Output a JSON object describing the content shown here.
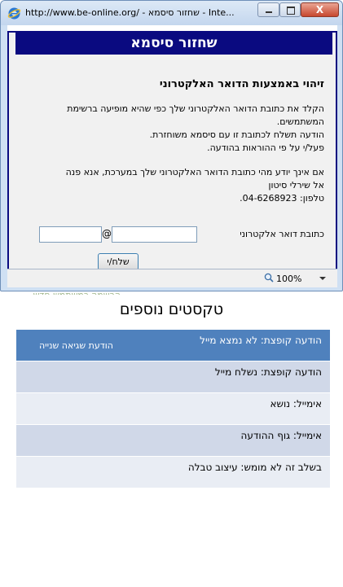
{
  "window": {
    "title": "http://www.be-online.org/ - שחזור סיסמא - Inte...",
    "icon": "internet-explorer-icon",
    "close_glyph": "X"
  },
  "page": {
    "banner": "שחזור סיסמא",
    "heading": "זיהוי באמצעות הדואר האלקטרוני",
    "para1": [
      "הקלד את כתובת הדואר האלקטרוני שלך כפי שהיא מופיעה ברשימת",
      "המשתמשים.",
      "הודעה תשלח לכתובת זו עם סיסמא משוחזרת.",
      "פעל/י על פי ההוראות בהודעה."
    ],
    "para2": [
      "אם אינך יודע מהי כתובת הדואר האלקטרוני שלך במערכת, אנא פנה",
      "אל שירלי סיטון",
      "טלפון: 04-6268923."
    ],
    "email_label": "כתובת דואר אלקטרוני",
    "email_user_value": "",
    "email_domain_value": "",
    "at_sign": "@",
    "send_label": "שלח/י"
  },
  "statusbar": {
    "zoom": "100%"
  },
  "behind_text": "הרשמה כמשתמש חדש",
  "document": {
    "title": "טקסטים נוספים",
    "rows": [
      {
        "text": "הודעה קופצת: לא נמצא מייל",
        "sub": "הודעת שגיאה שנייה"
      },
      {
        "text": "הודעה קופצת: נשלח מייל"
      },
      {
        "text": "אימייל: נושא"
      },
      {
        "text": "אימייל: גוף ההודעה"
      },
      {
        "text": "בשלב זה לא מומש: עיצוב טבלה"
      }
    ]
  },
  "colors": {
    "banner": "#0a0a80",
    "table_header": "#4f81bd",
    "table_row_dark": "#d0d8e8",
    "table_row_light": "#e9edf4"
  }
}
